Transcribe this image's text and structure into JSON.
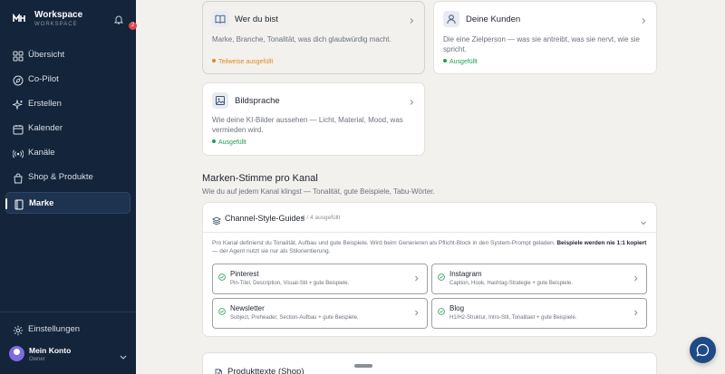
{
  "sidebar": {
    "brand_title": "Workspace",
    "brand_subtitle": "WORKSPACE",
    "notification_count": "2",
    "items": [
      {
        "label": "Übersicht",
        "icon": "grid-icon"
      },
      {
        "label": "Co-Pilot",
        "icon": "compass-icon"
      },
      {
        "label": "Erstellen",
        "icon": "sparkle-icon"
      },
      {
        "label": "Kalender",
        "icon": "calendar-icon"
      },
      {
        "label": "Kanäle",
        "icon": "broadcast-icon"
      },
      {
        "label": "Shop & Produkte",
        "icon": "bag-icon"
      },
      {
        "label": "Marke",
        "icon": "book-icon",
        "active": true
      }
    ],
    "settings_label": "Einstellungen",
    "account_name": "Mein Konto",
    "account_role": "Owner"
  },
  "cards": [
    {
      "title": "Wer du bist",
      "icon": "book-open-icon",
      "desc": "Marke, Branche, Tonalität, was dich glaubwürdig macht.",
      "status": "Teilweise ausgefüllt",
      "status_color": "#e08a1e",
      "selected": true
    },
    {
      "title": "Deine Kunden",
      "icon": "user-icon",
      "desc": "Die eine Zielperson — was sie antreibt, was sie nervt, wie sie spricht.",
      "status": "Ausgefüllt",
      "status_color": "#1f9d55"
    },
    {
      "title": "Bildsprache",
      "icon": "image-icon",
      "desc": "Wie deine KI-Bilder aussehen — Licht, Material, Mood, was vermieden wird.",
      "status": "Ausgefüllt",
      "status_color": "#1f9d55"
    }
  ],
  "section": {
    "title": "Marken-Stimme pro Kanal",
    "subtitle": "Wie du auf jedem Kanal klingst — Tonalität, gute Beispiele, Tabu-Wörter."
  },
  "guides": {
    "title": "Channel-Style-Guides",
    "count": "4 / 4 ausgefüllt",
    "intro_a": "Pro Kanal definierst du Tonalität, Aufbau und gute Beispiele. Wird beim Generieren als Pflicht-Block in den System-Prompt geladen. ",
    "intro_b": "Beispiele werden nie 1:1 kopiert",
    "intro_c": " — der Agent nutzt sie nur als Stilorientierung.",
    "channels": [
      {
        "name": "Pinterest",
        "desc": "Pin-Titel, Description, Visual-Stil + gute Beispiele."
      },
      {
        "name": "Instagram",
        "desc": "Caption, Hook, Hashtag-Strategie + gute Beispiele."
      },
      {
        "name": "Newsletter",
        "desc": "Subject, Preheader, Section-Aufbau + gute Beispiele."
      },
      {
        "name": "Blog",
        "desc": "H1/H2-Struktur, Intro-Stil, Tonalitaet + gute Beispiele."
      }
    ]
  },
  "bottom_card": {
    "title": "Produkttexte (Shop)"
  },
  "colors": {
    "sidebar": "#14243a",
    "accent": "#1e4a86",
    "ok": "#1f9d55",
    "partial": "#e08a1e"
  }
}
